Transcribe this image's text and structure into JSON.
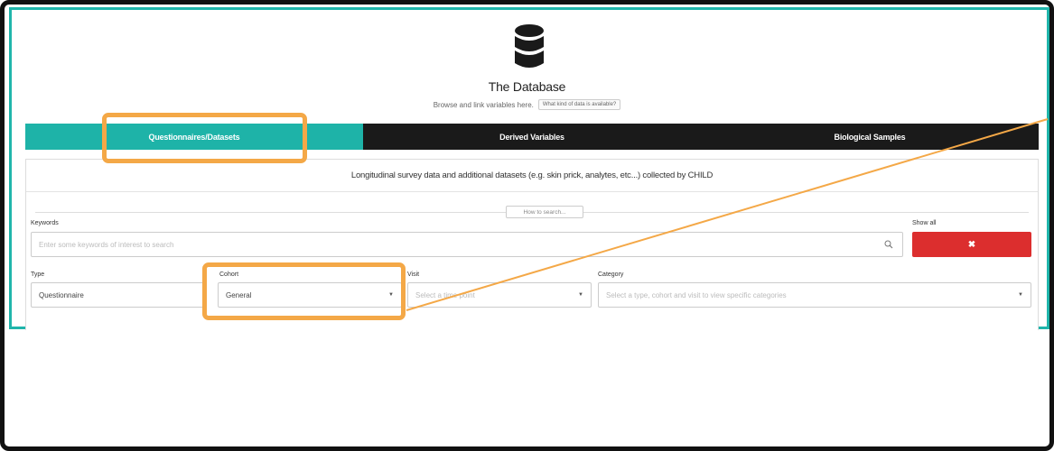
{
  "header": {
    "icon": "database-icon",
    "title": "The Database",
    "subtitle": "Browse and link variables here.",
    "help_button": "What kind of data is available?"
  },
  "tabs": [
    {
      "label": "Questionnaires/Datasets",
      "active": true
    },
    {
      "label": "Derived Variables",
      "active": false
    },
    {
      "label": "Biological Samples",
      "active": false
    }
  ],
  "panel": {
    "description": "Longitudinal survey data and additional datasets (e.g. skin prick, analytes, etc...) collected by CHILD",
    "how_to_search": "How to search..."
  },
  "filters": {
    "keywords_label": "Keywords",
    "keywords_placeholder": "Enter some keywords of interest to search",
    "show_all_label": "Show all",
    "clear_icon": "✖",
    "type_label": "Type",
    "type_value": "Questionnaire",
    "cohort_label": "Cohort",
    "cohort_value": "General",
    "visit_label": "Visit",
    "visit_placeholder": "Select a time point",
    "category_label": "Category",
    "category_placeholder": "Select a type, cohort and visit to view specific categories"
  },
  "colors": {
    "accent": "#1eb3a8",
    "dark_tab": "#1a1a1a",
    "danger": "#dc2e2e",
    "highlight": "#f4a847"
  }
}
